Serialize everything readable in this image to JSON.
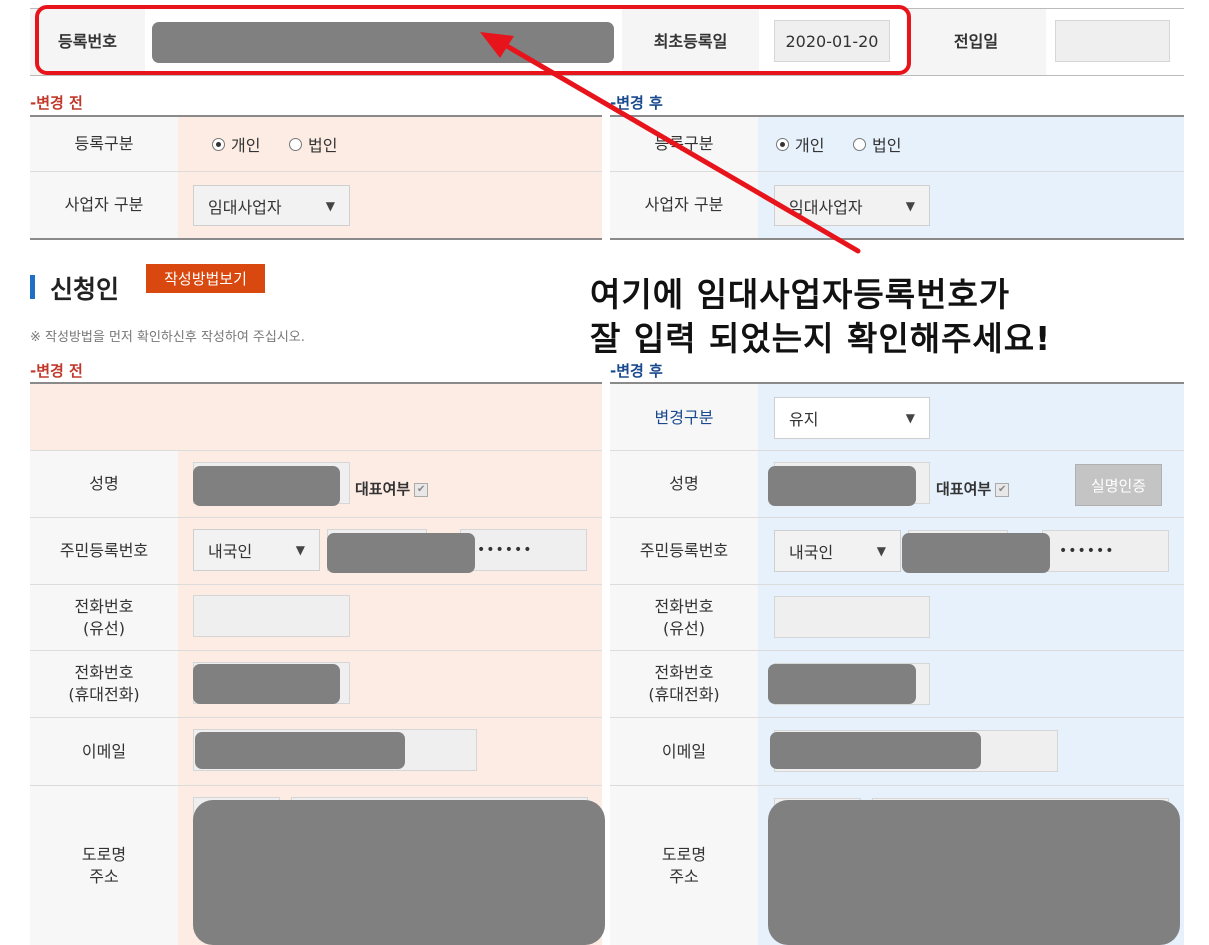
{
  "top_row": {
    "reg_no_label": "등록번호",
    "first_reg_label": "최초등록일",
    "first_reg_value": "2020-01-20",
    "move_in_label": "전입일"
  },
  "upper": {
    "before_tag": "-변경 전",
    "after_tag": "-변경 후",
    "reg_type_label": "등록구분",
    "radio_individual": "개인",
    "radio_corporate": "법인",
    "biz_type_label": "사업자 구분",
    "biz_type_value": "임대사업자"
  },
  "applicant": {
    "title": "신청인",
    "guide_button": "작성방법보기",
    "notice": "※ 작성방법을 먼저 확인하신후 작성하여 주십시오.",
    "before_tag": "-변경 전",
    "after_tag": "-변경 후",
    "change_type_label": "변경구분",
    "change_type_value": "유지",
    "name_label": "성명",
    "rep_label": "대표여부",
    "verify_button": "실명인증",
    "rrn_label": "주민등록번호",
    "nationality_value": "내국인",
    "rrn_masked": "••••••",
    "phone_label_1": "전화번호",
    "phone_label_2": "(유선)",
    "mobile_label_1": "전화번호",
    "mobile_label_2": "(휴대전화)",
    "email_label": "이메일",
    "address_label_1": "도로명",
    "address_label_2": "주소"
  },
  "annotation": {
    "line1": "여기에 임대사업자등록번호가",
    "line2": "잘 입력 되었는지 확인해주세요!",
    "highlight_color": "#e8141c"
  },
  "colors": {
    "before_bg": "#fdece4",
    "after_bg": "#e6f1fc",
    "before_accent": "#c0392b",
    "after_accent": "#1a4a8e",
    "guide_btn_bg": "#d9480f"
  }
}
